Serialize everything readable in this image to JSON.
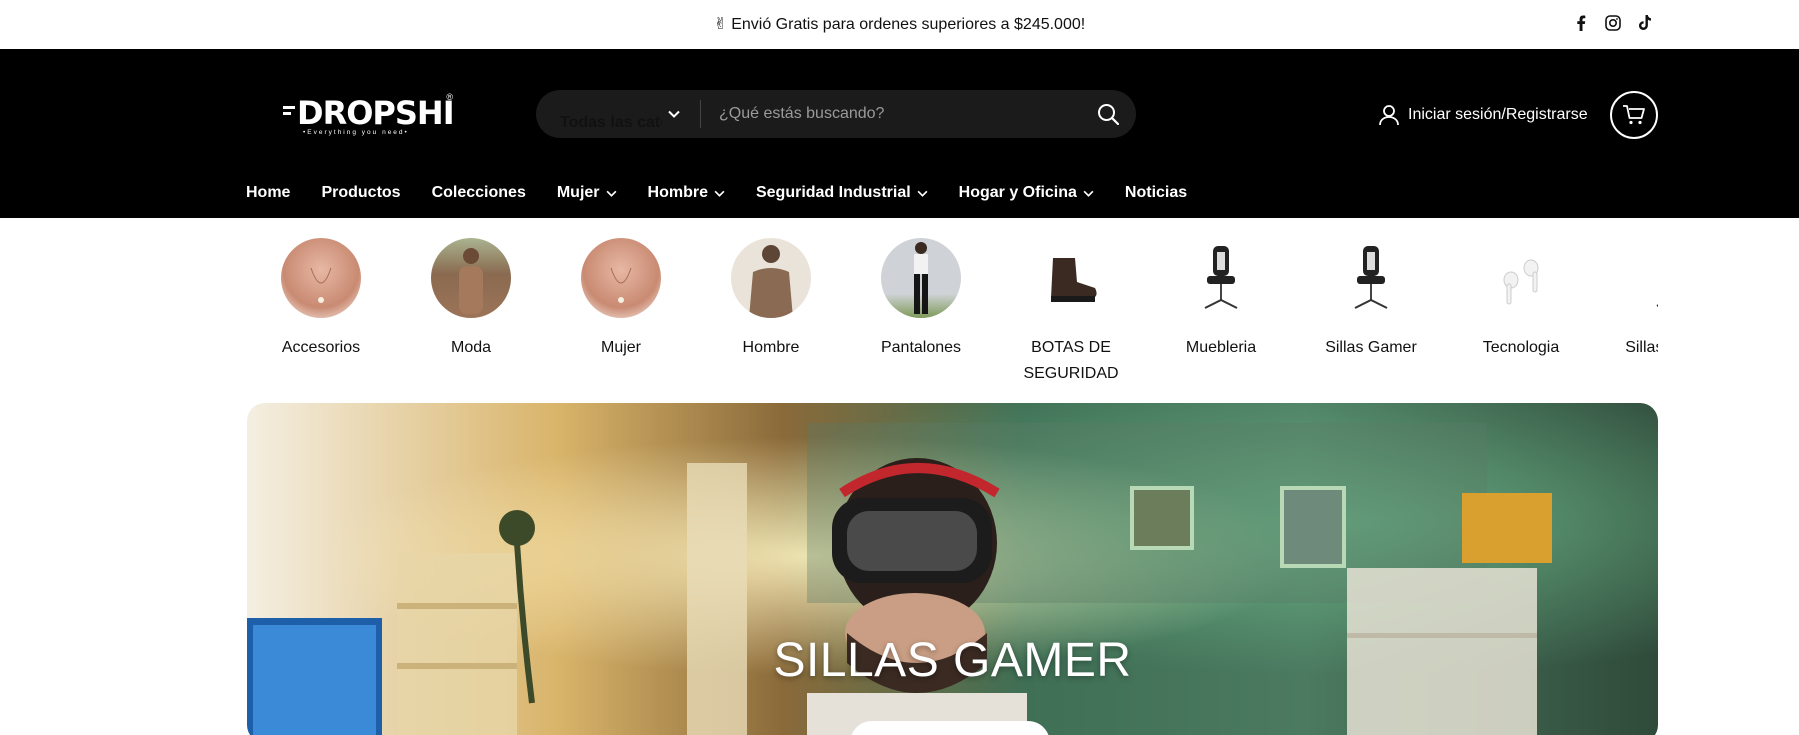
{
  "announcement": {
    "text": "Envió Gratis para ordenes superiores a $245.000!",
    "icon": "hand-peace-icon"
  },
  "social": [
    "facebook-icon",
    "instagram-icon",
    "tiktok-icon"
  ],
  "header": {
    "logo_text": "DROPSHI",
    "logo_tagline": "•Everything you need•",
    "logo_mark": "®",
    "search": {
      "category_label": "Todas las categorías",
      "placeholder": "¿Qué estás buscando?"
    },
    "login_label": "Iniciar sesión/Registrarse"
  },
  "nav": {
    "items": [
      {
        "label": "Home",
        "dropdown": false
      },
      {
        "label": "Productos",
        "dropdown": false
      },
      {
        "label": "Colecciones",
        "dropdown": false
      },
      {
        "label": "Mujer",
        "dropdown": true
      },
      {
        "label": "Hombre",
        "dropdown": true
      },
      {
        "label": "Seguridad Industrial",
        "dropdown": true
      },
      {
        "label": "Hogar y Oficina",
        "dropdown": true
      },
      {
        "label": "Noticias",
        "dropdown": false
      }
    ]
  },
  "categories": [
    {
      "label": "Accesorios"
    },
    {
      "label": "Moda"
    },
    {
      "label": "Mujer"
    },
    {
      "label": "Hombre"
    },
    {
      "label": "Pantalones"
    },
    {
      "label": "BOTAS DE SEGURIDAD"
    },
    {
      "label": "Muebleria"
    },
    {
      "label": "Sillas Gamer"
    },
    {
      "label": "Tecnologia"
    },
    {
      "label": "Sillas Gamer"
    }
  ],
  "hero": {
    "title": "SILLAS GAMER"
  },
  "colors": {
    "header_bg": "#000000",
    "search_bg": "#1b1b1b",
    "announcement_bg": "#ffffff"
  }
}
